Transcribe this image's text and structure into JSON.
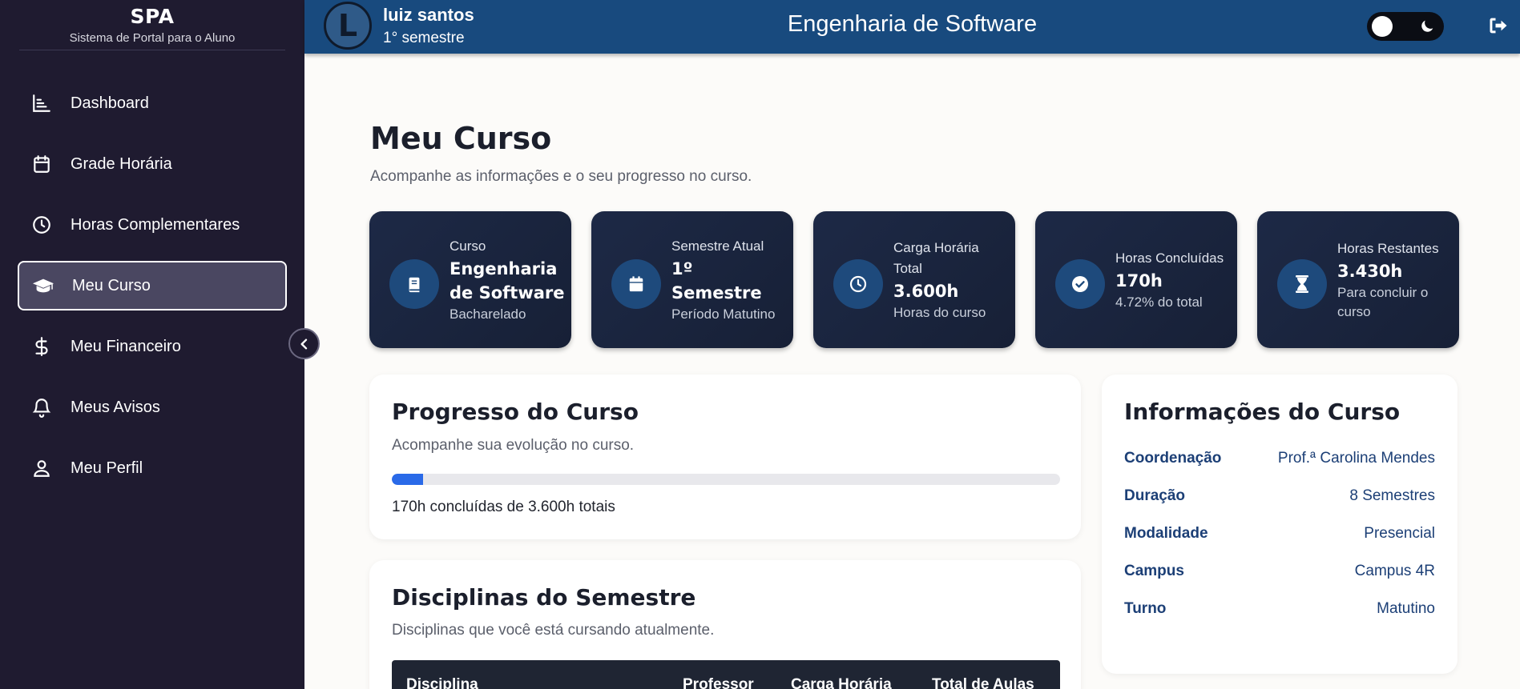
{
  "sidebar": {
    "brand_title": "SPA",
    "brand_subtitle": "Sistema de Portal para o Aluno",
    "items": [
      {
        "label": "Dashboard",
        "icon": "chart-icon"
      },
      {
        "label": "Grade Horária",
        "icon": "calendar-icon"
      },
      {
        "label": "Horas Complementares",
        "icon": "clock-icon"
      },
      {
        "label": "Meu Curso",
        "icon": "graduation-cap-icon",
        "active": true
      },
      {
        "label": "Meu Financeiro",
        "icon": "dollar-icon"
      },
      {
        "label": "Meus Avisos",
        "icon": "bell-icon"
      },
      {
        "label": "Meu Perfil",
        "icon": "user-icon"
      }
    ]
  },
  "header": {
    "avatar_letter": "L",
    "user_name": "luiz santos",
    "user_semester": "1° semestre",
    "title": "Engenharia de Software",
    "accent": "#184a7e"
  },
  "page": {
    "title": "Meu Curso",
    "subtitle": "Acompanhe as informações e o seu progresso no curso."
  },
  "stats": [
    {
      "label": "Curso",
      "value": "Engenharia de Software",
      "note": "Bacharelado",
      "icon": "book-icon"
    },
    {
      "label": "Semestre Atual",
      "value": "1º Semestre",
      "note": "Período Matutino",
      "icon": "calendar-icon"
    },
    {
      "label": "Carga Horária Total",
      "value": "3.600h",
      "note": "Horas do curso",
      "icon": "clock-icon"
    },
    {
      "label": "Horas Concluídas",
      "value": "170h",
      "note": "4.72% do total",
      "icon": "check-circle-icon"
    },
    {
      "label": "Horas Restantes",
      "value": "3.430h",
      "note": "Para concluir o curso",
      "icon": "hourglass-icon"
    }
  ],
  "progress": {
    "title": "Progresso do Curso",
    "subtitle": "Acompanhe sua evolução no curso.",
    "percent": 4.72,
    "text": "170h concluídas de 3.600h totais",
    "bar_color": "#2a6ae8"
  },
  "disciplines": {
    "title": "Disciplinas do Semestre",
    "subtitle": "Disciplinas que você está cursando atualmente.",
    "columns": [
      "Disciplina",
      "Professor",
      "Carga Horária",
      "Total de Aulas"
    ]
  },
  "info": {
    "title": "Informações do Curso",
    "rows": [
      {
        "key": "Coordenação",
        "value": "Prof.ª Carolina Mendes"
      },
      {
        "key": "Duração",
        "value": "8 Semestres"
      },
      {
        "key": "Modalidade",
        "value": "Presencial"
      },
      {
        "key": "Campus",
        "value": "Campus 4R"
      },
      {
        "key": "Turno",
        "value": "Matutino"
      }
    ]
  }
}
